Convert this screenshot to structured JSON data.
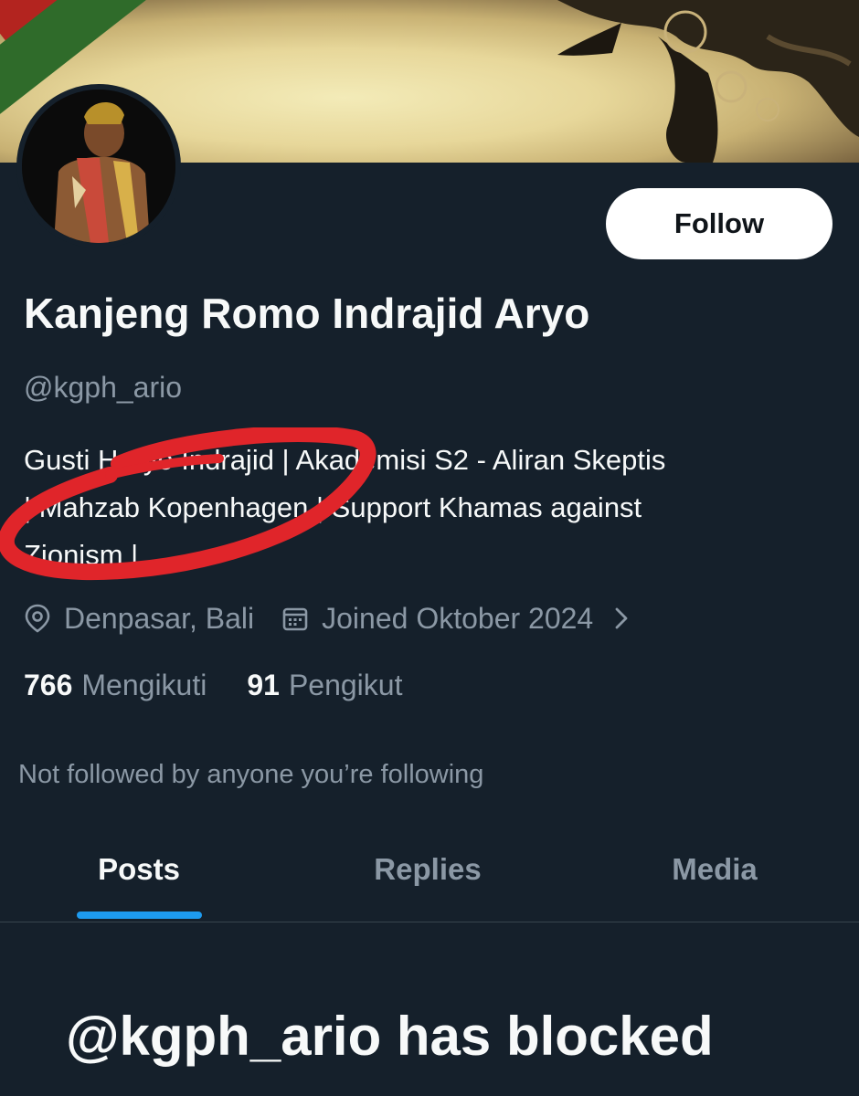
{
  "profile": {
    "follow_label": "Follow",
    "name": "Kanjeng Romo Indrajid Aryo",
    "handle": "@kgph_ario",
    "bio_lines": [
      "Gusti Haryo Indrajid | Akademisi S2 - Aliran Skeptis",
      "| Mahzab Kopenhagen | Support Khamas against",
      "Zionism |"
    ],
    "location": "Denpasar, Bali",
    "joined": "Joined Oktober 2024",
    "following_count": "766",
    "following_label": "Mengikuti",
    "followers_count": "91",
    "followers_label": "Pengikut",
    "mutuals_text": "Not followed by anyone you’re following"
  },
  "tabs": [
    {
      "label": "Posts",
      "active": true
    },
    {
      "label": "Replies",
      "active": false
    },
    {
      "label": "Media",
      "active": false
    }
  ],
  "blocked_message": "@kgph_ario has blocked",
  "colors": {
    "background": "#15202b",
    "accent": "#1d9bf0",
    "muted_text": "#8b98a5",
    "scribble": "#e0252a"
  }
}
